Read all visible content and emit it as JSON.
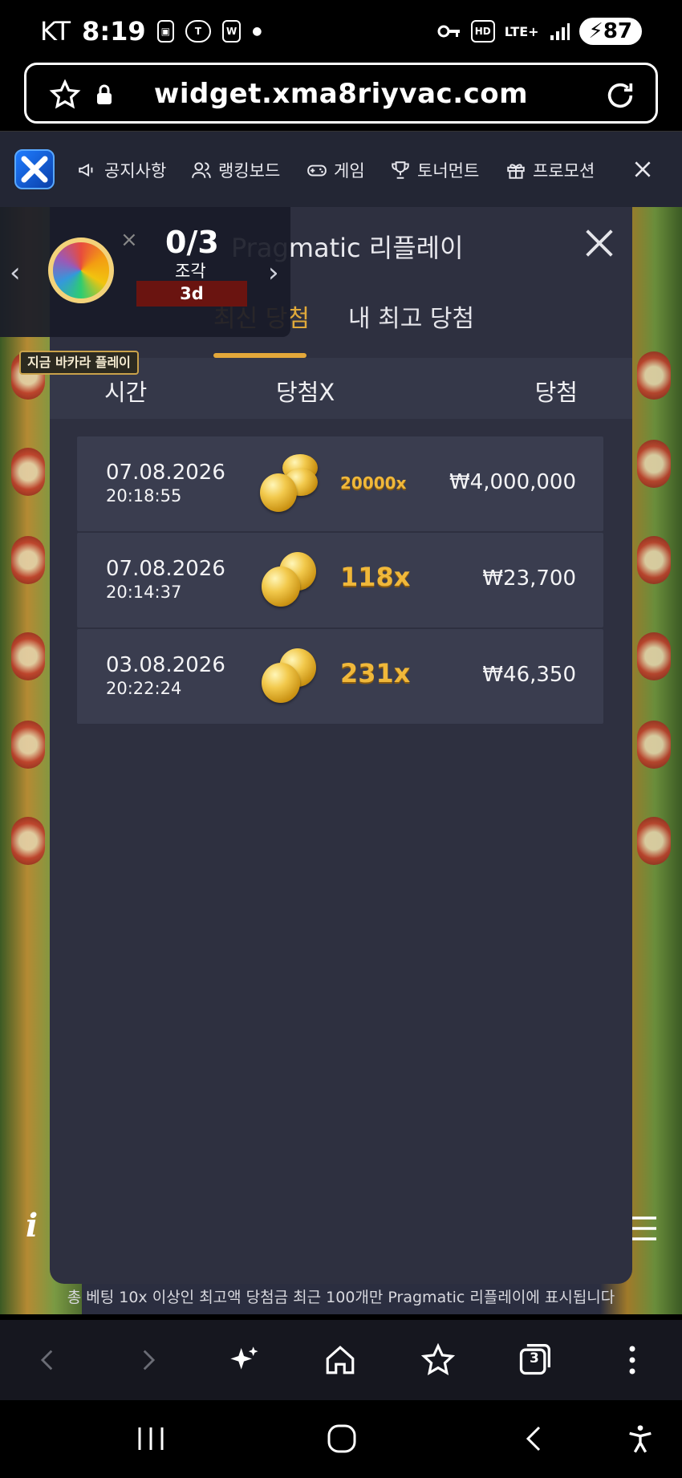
{
  "status_bar": {
    "carrier": "KT",
    "time": "8:19",
    "battery": "87",
    "network": "LTE+"
  },
  "browser": {
    "url": "widget.xma8riyvac.com"
  },
  "nav": {
    "items": [
      "공지사항",
      "랭킹보드",
      "게임",
      "토너먼트",
      "프로모션"
    ]
  },
  "collect_widget": {
    "progress": "0/3",
    "label": "조각",
    "time_left": "3d"
  },
  "play_label": "지금 바카라 플레이",
  "modal": {
    "title": "Pragmatic 리플레이",
    "tabs": [
      "최신 당첨",
      "내 최고 당첨"
    ],
    "active_tab": 0,
    "columns": [
      "시간",
      "당첨X",
      "당첨"
    ],
    "rows": [
      {
        "date": "07.08.2026",
        "time": "20:18:55",
        "multiplier": "20000x",
        "amount": "₩4,000,000"
      },
      {
        "date": "07.08.2026",
        "time": "20:14:37",
        "multiplier": "118x",
        "amount": "₩23,700"
      },
      {
        "date": "03.08.2026",
        "time": "20:22:24",
        "multiplier": "231x",
        "amount": "₩46,350"
      }
    ],
    "footer": "총 베팅 10x 이상인 최고액 당첨금 최근 100개만 Pragmatic 리플레이에 표시됩니다"
  },
  "browser_toolbar": {
    "tabs_count": "3"
  },
  "colors": {
    "accent": "#e4a83a",
    "modal_bg": "#2e3040",
    "row_bg": "#3a3d4f",
    "multiplier": "#f0b83a"
  }
}
